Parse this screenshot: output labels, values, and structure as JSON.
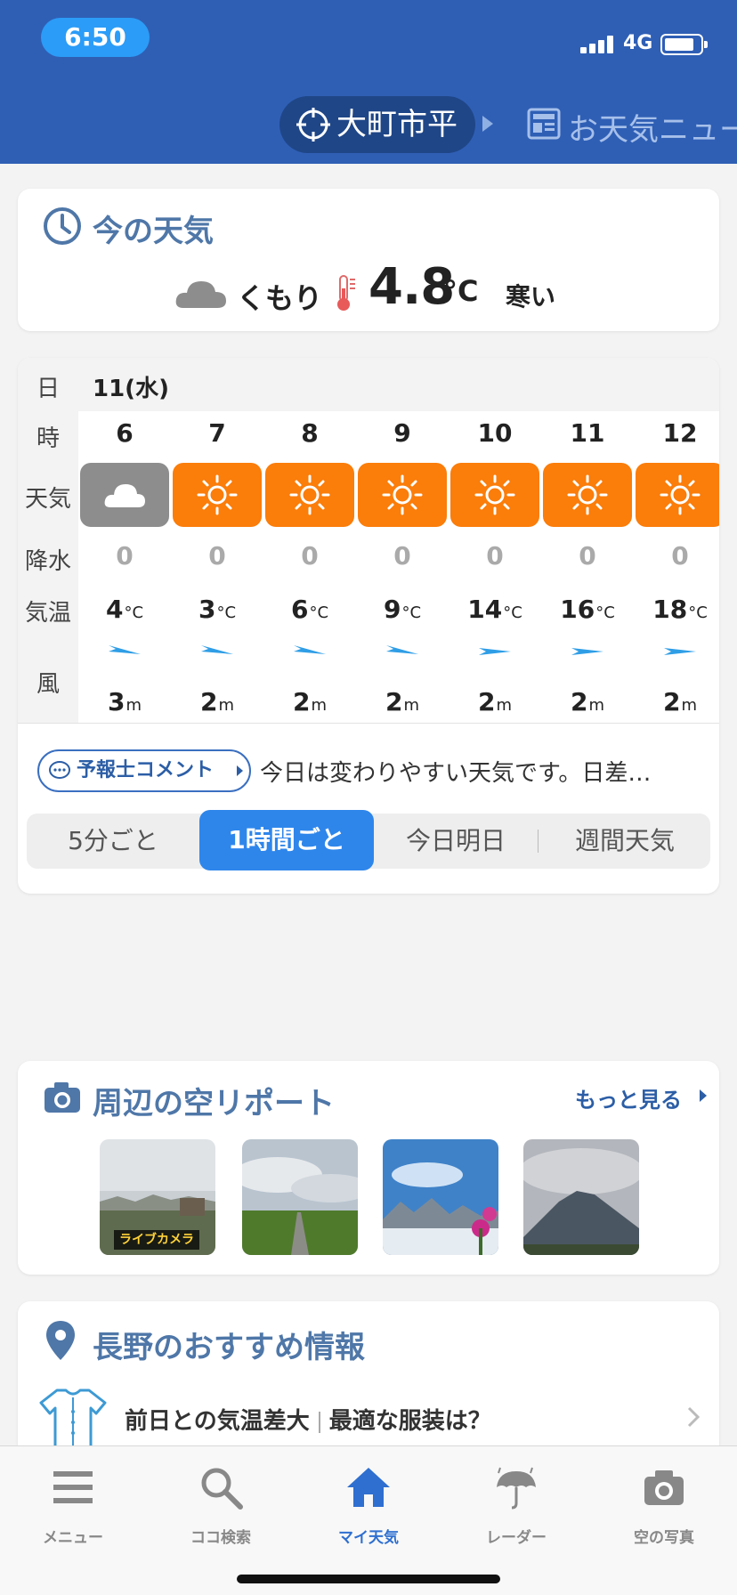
{
  "status_bar": {
    "time": "6:50",
    "network": "4G"
  },
  "header": {
    "location": "大町市平",
    "next_label": "お天気ニュー"
  },
  "now": {
    "title": "今の天気",
    "condition": "くもり",
    "temperature": "4.8",
    "unit": "°C",
    "feel": "寒い",
    "icons": {
      "clock": "clock-icon",
      "weather": "cloud-icon",
      "thermometer": "thermometer-icon"
    }
  },
  "hourly": {
    "row_labels": {
      "date": "日",
      "hour": "時",
      "weather": "天気",
      "precip": "降水",
      "temp": "気温",
      "wind": "風"
    },
    "date": "11(水)",
    "temp_unit": "°C",
    "wind_unit": "m",
    "hours": [
      {
        "hour": "6",
        "weather": "cloudy",
        "precip": "0",
        "temp": "4",
        "wind": "3"
      },
      {
        "hour": "7",
        "weather": "sunny",
        "precip": "0",
        "temp": "3",
        "wind": "2"
      },
      {
        "hour": "8",
        "weather": "sunny",
        "precip": "0",
        "temp": "6",
        "wind": "2"
      },
      {
        "hour": "9",
        "weather": "sunny",
        "precip": "0",
        "temp": "9",
        "wind": "2"
      },
      {
        "hour": "10",
        "weather": "sunny",
        "precip": "0",
        "temp": "14",
        "wind": "2"
      },
      {
        "hour": "11",
        "weather": "sunny",
        "precip": "0",
        "temp": "16",
        "wind": "2"
      },
      {
        "hour": "12",
        "weather": "sunny",
        "precip": "0",
        "temp": "18",
        "wind": "2"
      }
    ],
    "colors": {
      "sunny": "#fb7d0a",
      "cloudy": "#8d8d8d",
      "wind_arrow": "#2f9ee6"
    },
    "comment_button": "予報士コメント",
    "comment_text": "今日は変わりやすい天気です。日差…",
    "tabs": [
      "5分ごと",
      "1時間ごと",
      "今日明日",
      "週間天気"
    ],
    "active_tab": "1時間ごと"
  },
  "sky": {
    "title": "周辺の空リポート",
    "more": "もっと見る",
    "live_badge": "ライブカメラ"
  },
  "recommend": {
    "title": "長野のおすすめ情報",
    "item_main": "前日との気温差大",
    "item_sub": "最適な服装は？"
  },
  "tabbar": {
    "items": [
      "メニュー",
      "ココ検索",
      "マイ天気",
      "レーダー",
      "空の写真"
    ],
    "active": "マイ天気"
  },
  "accent_color": "#2f5fb5"
}
